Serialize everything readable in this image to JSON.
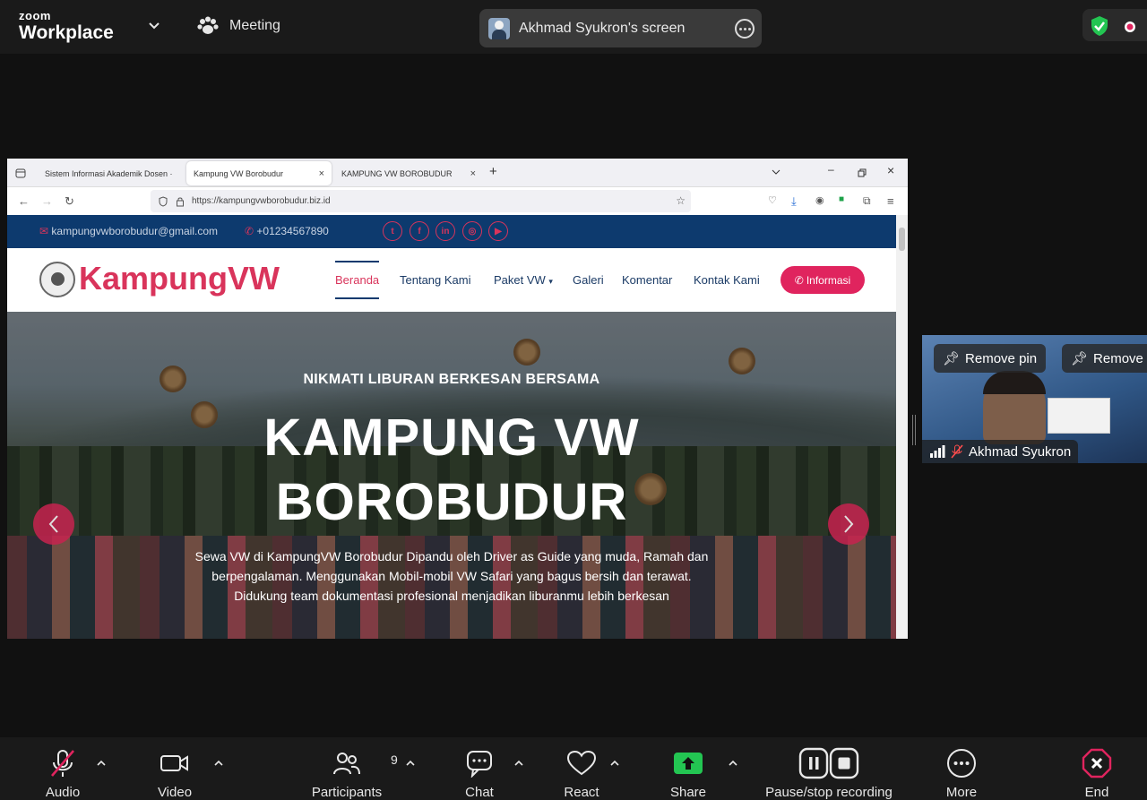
{
  "app": {
    "logo_small": "zoom",
    "logo_big": "Workplace",
    "meeting_label": "Meeting"
  },
  "screen_share": {
    "label": "Akhmad Syukron's screen"
  },
  "browser": {
    "tabs": [
      {
        "label": "Sistem Informasi Akademik Dosen ·"
      },
      {
        "label": "Kampung VW Borobudur"
      },
      {
        "label": "KAMPUNG VW BOROBUDUR"
      }
    ],
    "new_tab": "+",
    "url": "https://kampungvwborobudur.biz.id"
  },
  "website": {
    "email": "kampungvwborobudur@gmail.com",
    "phone": "+01234567890",
    "brand": "KampungVW",
    "nav": [
      "Beranda",
      "Tentang Kami",
      "Paket VW",
      "Galeri",
      "Komentar",
      "Kontak Kami"
    ],
    "info_button": "Informasi",
    "hero_sub": "NIKMATI LIBURAN BERKESAN BERSAMA",
    "hero_title_1": "KAMPUNG VW",
    "hero_title_2": "BOROBUDUR",
    "hero_desc_1": "Sewa VW di KampungVW Borobudur Dipandu oleh Driver as Guide yang muda, Ramah dan",
    "hero_desc_2": "berpengalaman. Menggunakan Mobil-mobil VW Safari yang bagus bersih dan terawat.",
    "hero_desc_3": "Didukung team dokumentasi profesional menjadikan liburanmu lebih berkesan",
    "colors": {
      "accent": "#d9345b",
      "navy": "#0d3a6e"
    }
  },
  "participant": {
    "name": "Akhmad Syukron",
    "remove_pin": "Remove pin",
    "remove_spotlight": "Remove"
  },
  "toolbar": {
    "audio": "Audio",
    "video": "Video",
    "participants": "Participants",
    "participant_count": "9",
    "chat": "Chat",
    "react": "React",
    "share": "Share",
    "record": "Pause/stop recording",
    "more": "More",
    "end": "End"
  }
}
